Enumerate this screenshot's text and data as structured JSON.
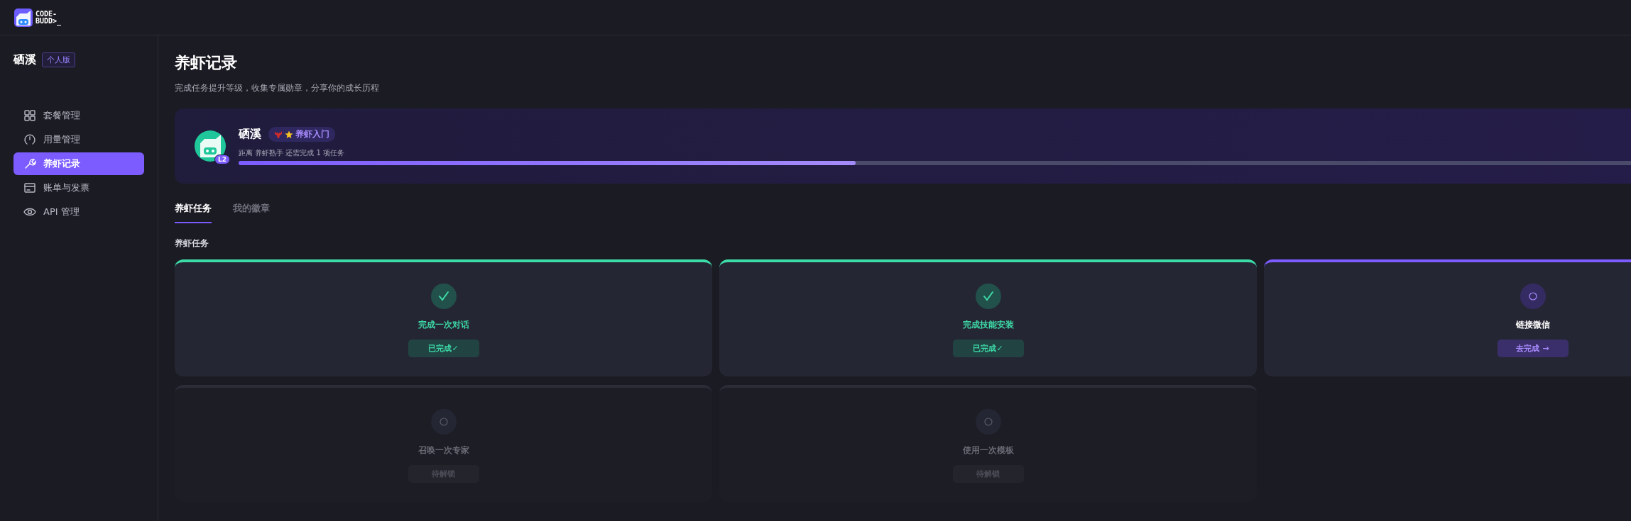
{
  "logo": {
    "lines": [
      "CODE-",
      "BUDD>_"
    ]
  },
  "sidebar": {
    "user": "硒溪",
    "plan_badge": "个人版",
    "items": [
      {
        "label": "套餐管理",
        "selected": false
      },
      {
        "label": "用量管理",
        "selected": false
      },
      {
        "label": "养虾记录",
        "selected": true
      },
      {
        "label": "账单与发票",
        "selected": false
      },
      {
        "label": "API 管理",
        "selected": false
      }
    ]
  },
  "page": {
    "title": "养虾记录",
    "subtitle": "完成任务提升等级，收集专属勋章，分享你的成长历程"
  },
  "profile": {
    "name": "硒溪",
    "level_badge": "L2",
    "rank": "养虾入门",
    "progress_text": "距离 养虾熟手 还需完成 1 项任务",
    "level": 0.4
  },
  "tabs": [
    {
      "label": "养虾任务",
      "selected": true
    },
    {
      "label": "我的徽章",
      "selected": false
    }
  ],
  "section_title": "养虾任务",
  "tasks": [
    {
      "title": "完成一次对话",
      "kind": "done",
      "action": "已完成✓"
    },
    {
      "title": "完成技能安装",
      "kind": "done",
      "action": "已完成✓"
    },
    {
      "title": "链接微信",
      "kind": "available",
      "action": "去完成 →"
    },
    {
      "title": "召唤一次专家",
      "kind": "locked",
      "action": "待解锁"
    },
    {
      "title": "使用一次模板",
      "kind": "locked",
      "action": "待解锁"
    }
  ]
}
